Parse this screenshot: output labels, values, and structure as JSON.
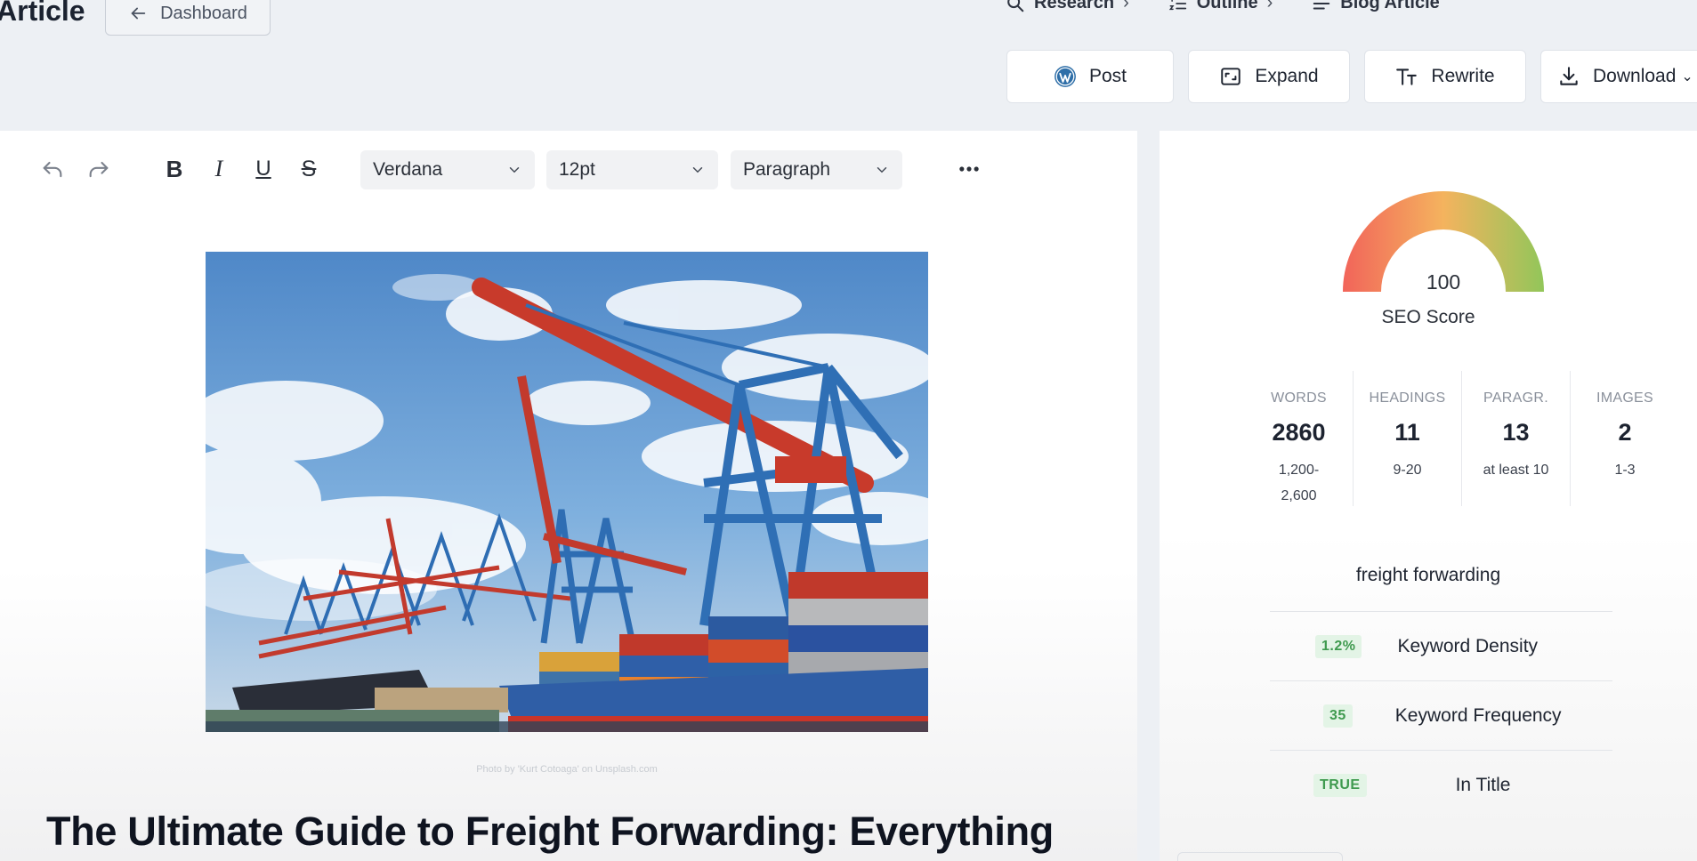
{
  "header": {
    "title": "Article",
    "back_label": "Dashboard",
    "breadcrumb": [
      {
        "label": "Research",
        "icon": "search-icon"
      },
      {
        "label": "Outline",
        "icon": "numbered-list-icon"
      },
      {
        "label": "Blog Article",
        "icon": "text-lines-icon"
      }
    ]
  },
  "actions": {
    "post": "Post",
    "expand": "Expand",
    "rewrite": "Rewrite",
    "download": "Download"
  },
  "toolbar": {
    "font": "Verdana",
    "size": "12pt",
    "block": "Paragraph"
  },
  "article": {
    "image_caption": "Photo by 'Kurt Cotoaga' on Unsplash.com",
    "heading": "The Ultimate Guide to Freight Forwarding: Everything"
  },
  "seo": {
    "score": "100",
    "score_label": "SEO Score",
    "gauge_colors": [
      "#f2645a",
      "#f4b35e",
      "#92c65a"
    ],
    "stats": [
      {
        "label": "WORDS",
        "value": "2860",
        "range_line1": "1,200-",
        "range_line2": "2,600"
      },
      {
        "label": "HEADINGS",
        "value": "11",
        "range_line1": "9-20",
        "range_line2": ""
      },
      {
        "label": "PARAGR.",
        "value": "13",
        "range_line1": "at least 10",
        "range_line2": ""
      },
      {
        "label": "IMAGES",
        "value": "2",
        "range_line1": "1-3",
        "range_line2": ""
      }
    ],
    "keyword": "freight forwarding",
    "metrics": [
      {
        "badge": "1.2%",
        "label": "Keyword Density"
      },
      {
        "badge": "35",
        "label": "Keyword Frequency"
      },
      {
        "badge": "TRUE",
        "label": "In Title"
      }
    ]
  }
}
